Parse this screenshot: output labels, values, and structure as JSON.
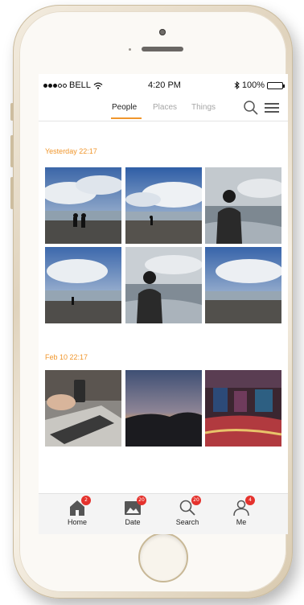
{
  "status_bar": {
    "carrier": "BELL",
    "time": "4:20 PM",
    "battery": "100%"
  },
  "nav": {
    "tabs": [
      {
        "label": "People",
        "active": true
      },
      {
        "label": "Places",
        "active": false
      },
      {
        "label": "Things",
        "active": false
      }
    ],
    "search_icon": "search-icon",
    "menu_icon": "hamburger-menu-icon"
  },
  "groups": [
    {
      "date_label": "Yesterday 22:17",
      "photos": [
        {
          "subject": "couple silhouettes on beach under cloudy sky"
        },
        {
          "subject": "person walking on beach under cloudy sky"
        },
        {
          "subject": "man looking at sea, back view"
        },
        {
          "subject": "cloudy sky over sea, small figure"
        },
        {
          "subject": "man looking at sea, back view"
        },
        {
          "subject": "cloudy sky over sea"
        }
      ]
    },
    {
      "date_label": "Feb 10 22:17",
      "photos": [
        {
          "subject": "laptop and phone on desk"
        },
        {
          "subject": "sunset over mountains"
        },
        {
          "subject": "casino interior"
        }
      ]
    }
  ],
  "tab_bar": [
    {
      "label": "Home",
      "icon": "home-icon",
      "badge": "2"
    },
    {
      "label": "Date",
      "icon": "photo-icon",
      "badge": "20"
    },
    {
      "label": "Search",
      "icon": "search-icon",
      "badge": "20"
    },
    {
      "label": "Me",
      "icon": "person-icon",
      "badge": "4"
    }
  ],
  "colors": {
    "accent": "#f0962c",
    "badge": "#e5322d"
  }
}
